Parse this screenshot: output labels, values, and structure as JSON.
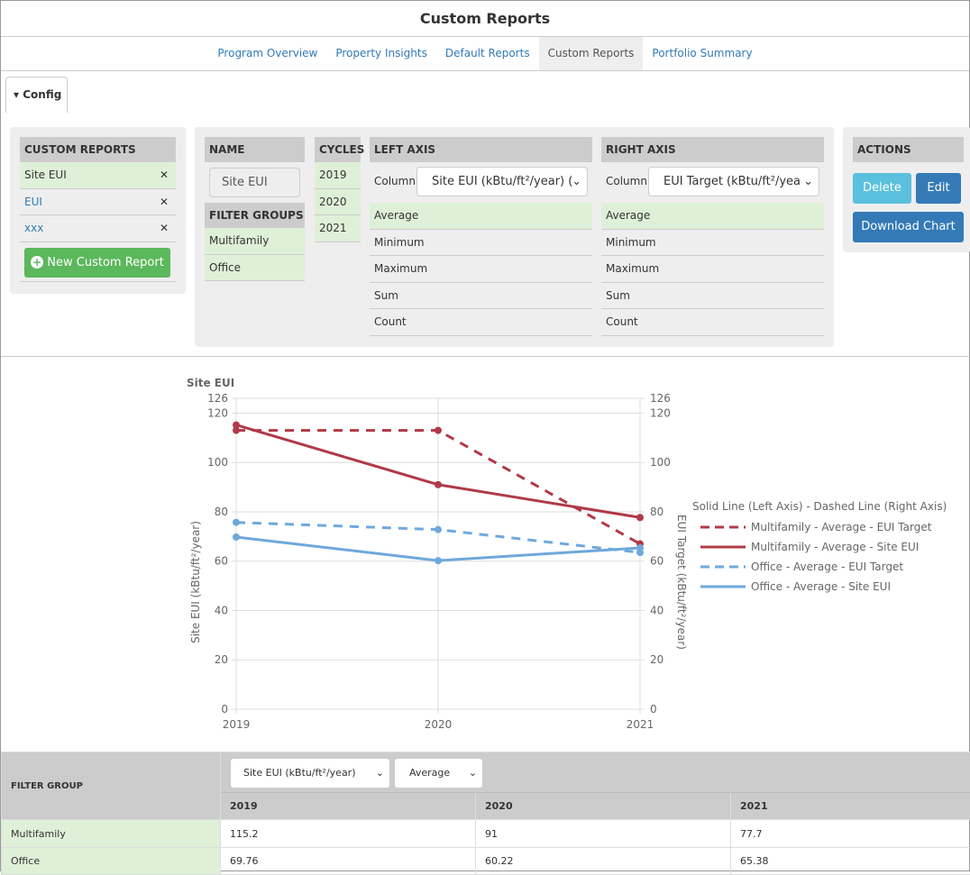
{
  "title": "Custom Reports",
  "nav": [
    "Program Overview",
    "Property Insights",
    "Default Reports",
    "Custom Reports",
    "Portfolio Summary"
  ],
  "config_label": "Config",
  "custom_reports": {
    "header": "CUSTOM REPORTS",
    "items": [
      "Site EUI",
      "EUI",
      "xxx"
    ],
    "new_button": "New Custom Report"
  },
  "name": {
    "header": "NAME",
    "value": "Site EUI"
  },
  "filter_groups": {
    "header": "FILTER GROUPS",
    "items": [
      "Multifamily",
      "Office"
    ]
  },
  "cycles": {
    "header": "CYCLES",
    "items": [
      "2019",
      "2020",
      "2021"
    ]
  },
  "left_axis": {
    "header": "LEFT AXIS",
    "column_label": "Column",
    "column_value": "Site EUI (kBtu/ft²/year) (",
    "aggs": [
      "Average",
      "Minimum",
      "Maximum",
      "Sum",
      "Count"
    ]
  },
  "right_axis": {
    "header": "RIGHT AXIS",
    "column_label": "Column",
    "column_value": "EUI Target (kBtu/ft²/yea",
    "aggs": [
      "Average",
      "Minimum",
      "Maximum",
      "Sum",
      "Count"
    ]
  },
  "actions": {
    "header": "ACTIONS",
    "delete": "Delete",
    "edit": "Edit",
    "download": "Download Chart"
  },
  "colors": {
    "multifamily": "#b03a48",
    "office": "#6fa8dc",
    "selected": "#dff0d8",
    "success": "#5cb85c",
    "primary": "#337ab7",
    "info": "#5bc0de"
  },
  "chart_data": {
    "type": "line",
    "title": "Site EUI",
    "x": [
      "2019",
      "2020",
      "2021"
    ],
    "ylabel": "Site EUI (kBtu/ft²/year)",
    "y2label": "EUI Target (kBtu/ft²/year)",
    "ylim": [
      0,
      126
    ],
    "y2lim": [
      0,
      126
    ],
    "yticks": [
      0,
      20,
      40,
      60,
      80,
      100,
      120,
      126
    ],
    "legend_title": "Solid Line (Left Axis) - Dashed Line (Right Axis)",
    "legend_position": "right",
    "series": [
      {
        "name": "Multifamily - Average - EUI Target",
        "values": [
          113,
          113,
          67
        ],
        "dashed": true,
        "color": "#b03a48",
        "axis": "right"
      },
      {
        "name": "Multifamily - Average - Site EUI",
        "values": [
          115.2,
          91,
          77.7
        ],
        "dashed": false,
        "color": "#b03a48",
        "axis": "left"
      },
      {
        "name": "Office - Average - EUI Target",
        "values": [
          75.7,
          72.8,
          63.5
        ],
        "dashed": true,
        "color": "#6fa8dc",
        "axis": "right"
      },
      {
        "name": "Office - Average - Site EUI",
        "values": [
          69.76,
          60.22,
          65.38
        ],
        "dashed": false,
        "color": "#6fa8dc",
        "axis": "left"
      }
    ]
  },
  "table": {
    "header": "FILTER GROUP",
    "column_select": "Site EUI (kBtu/ft²/year)",
    "agg_select": "Average",
    "years": [
      "2019",
      "2020",
      "2021"
    ],
    "rows": [
      {
        "group": "Multifamily",
        "values": [
          "115.2",
          "91",
          "77.7"
        ]
      },
      {
        "group": "Office",
        "values": [
          "69.76",
          "60.22",
          "65.38"
        ]
      }
    ]
  }
}
